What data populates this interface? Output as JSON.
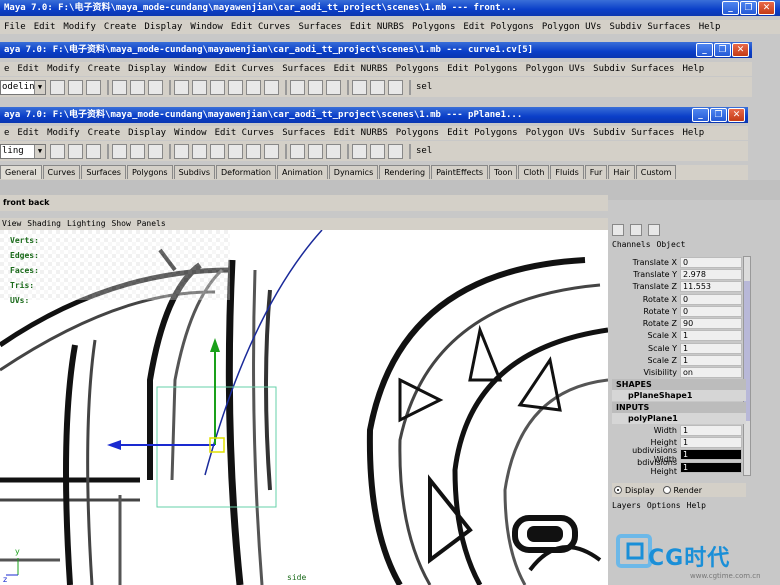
{
  "windows": [
    {
      "title": "Maya 7.0: F:\\电子资料\\maya_mode-cundang\\mayawenjian\\car_aodi_tt_project\\scenes\\1.mb   ---   front...",
      "menu": [
        "File",
        "Edit",
        "Modify",
        "Create",
        "Display",
        "Window",
        "Edit Curves",
        "Surfaces",
        "Edit NURBS",
        "Polygons",
        "Edit Polygons",
        "Polygon UVs",
        "Subdiv Surfaces",
        "Help"
      ]
    },
    {
      "title": "aya 7.0: F:\\电子资料\\maya_mode-cundang\\mayawenjian\\car_aodi_tt_project\\scenes\\1.mb   ---   curve1.cv[5]",
      "menu": [
        "e",
        "Edit",
        "Modify",
        "Create",
        "Display",
        "Window",
        "Edit Curves",
        "Surfaces",
        "Edit NURBS",
        "Polygons",
        "Edit Polygons",
        "Polygon UVs",
        "Subdiv Surfaces",
        "Help"
      ],
      "mode": "odeling",
      "sel_label": "sel"
    },
    {
      "title": "aya 7.0: F:\\电子资料\\maya_mode-cundang\\mayawenjian\\car_aodi_tt_project\\scenes\\1.mb   ---   pPlane1...",
      "menu": [
        "e",
        "Edit",
        "Modify",
        "Create",
        "Display",
        "Window",
        "Edit Curves",
        "Surfaces",
        "Edit NURBS",
        "Polygons",
        "Edit Polygons",
        "Polygon UVs",
        "Subdiv Surfaces",
        "Help"
      ],
      "mode": "ling",
      "sel_label": "sel"
    }
  ],
  "shelf_tabs": [
    "General",
    "Curves",
    "Surfaces",
    "Polygons",
    "Subdivs",
    "Deformation",
    "Animation",
    "Dynamics",
    "Rendering",
    "PaintEffects",
    "Toon",
    "Cloth",
    "Fluids",
    "Fur",
    "Hair",
    "Custom"
  ],
  "viewport": {
    "title": "front  back",
    "menu": [
      "View",
      "Shading",
      "Lighting",
      "Show",
      "Panels"
    ],
    "hud": [
      "Verts:",
      "Edges:",
      "Faces:",
      "Tris:",
      "UVs:"
    ],
    "axis_y": "y",
    "axis_z": "z",
    "camera_label": "side"
  },
  "channel_box": {
    "header": [
      "Channels",
      "Object"
    ],
    "channels": [
      {
        "label": "Translate X",
        "value": "0"
      },
      {
        "label": "Translate Y",
        "value": "2.978"
      },
      {
        "label": "Translate Z",
        "value": "11.553"
      },
      {
        "label": "Rotate X",
        "value": "0"
      },
      {
        "label": "Rotate Y",
        "value": "0"
      },
      {
        "label": "Rotate Z",
        "value": "90"
      },
      {
        "label": "Scale X",
        "value": "1"
      },
      {
        "label": "Scale Y",
        "value": "1"
      },
      {
        "label": "Scale Z",
        "value": "1"
      },
      {
        "label": "Visibility",
        "value": "on"
      }
    ],
    "shapes_label": "SHAPES",
    "shape_node": "pPlaneShape1",
    "inputs_label": "INPUTS",
    "input_node": "polyPlane1",
    "inputs": [
      {
        "label": "Width",
        "value": "1"
      },
      {
        "label": "Height",
        "value": "1"
      },
      {
        "label": "ubdivisions Width",
        "value": "1"
      },
      {
        "label": "bdivisions Height",
        "value": "1"
      }
    ],
    "display_label": "Display",
    "render_label": "Render",
    "layers_menu": [
      "Layers",
      "Options",
      "Help"
    ]
  },
  "watermark": {
    "text": "CG时代",
    "url": "www.cgtime.com.cn"
  }
}
